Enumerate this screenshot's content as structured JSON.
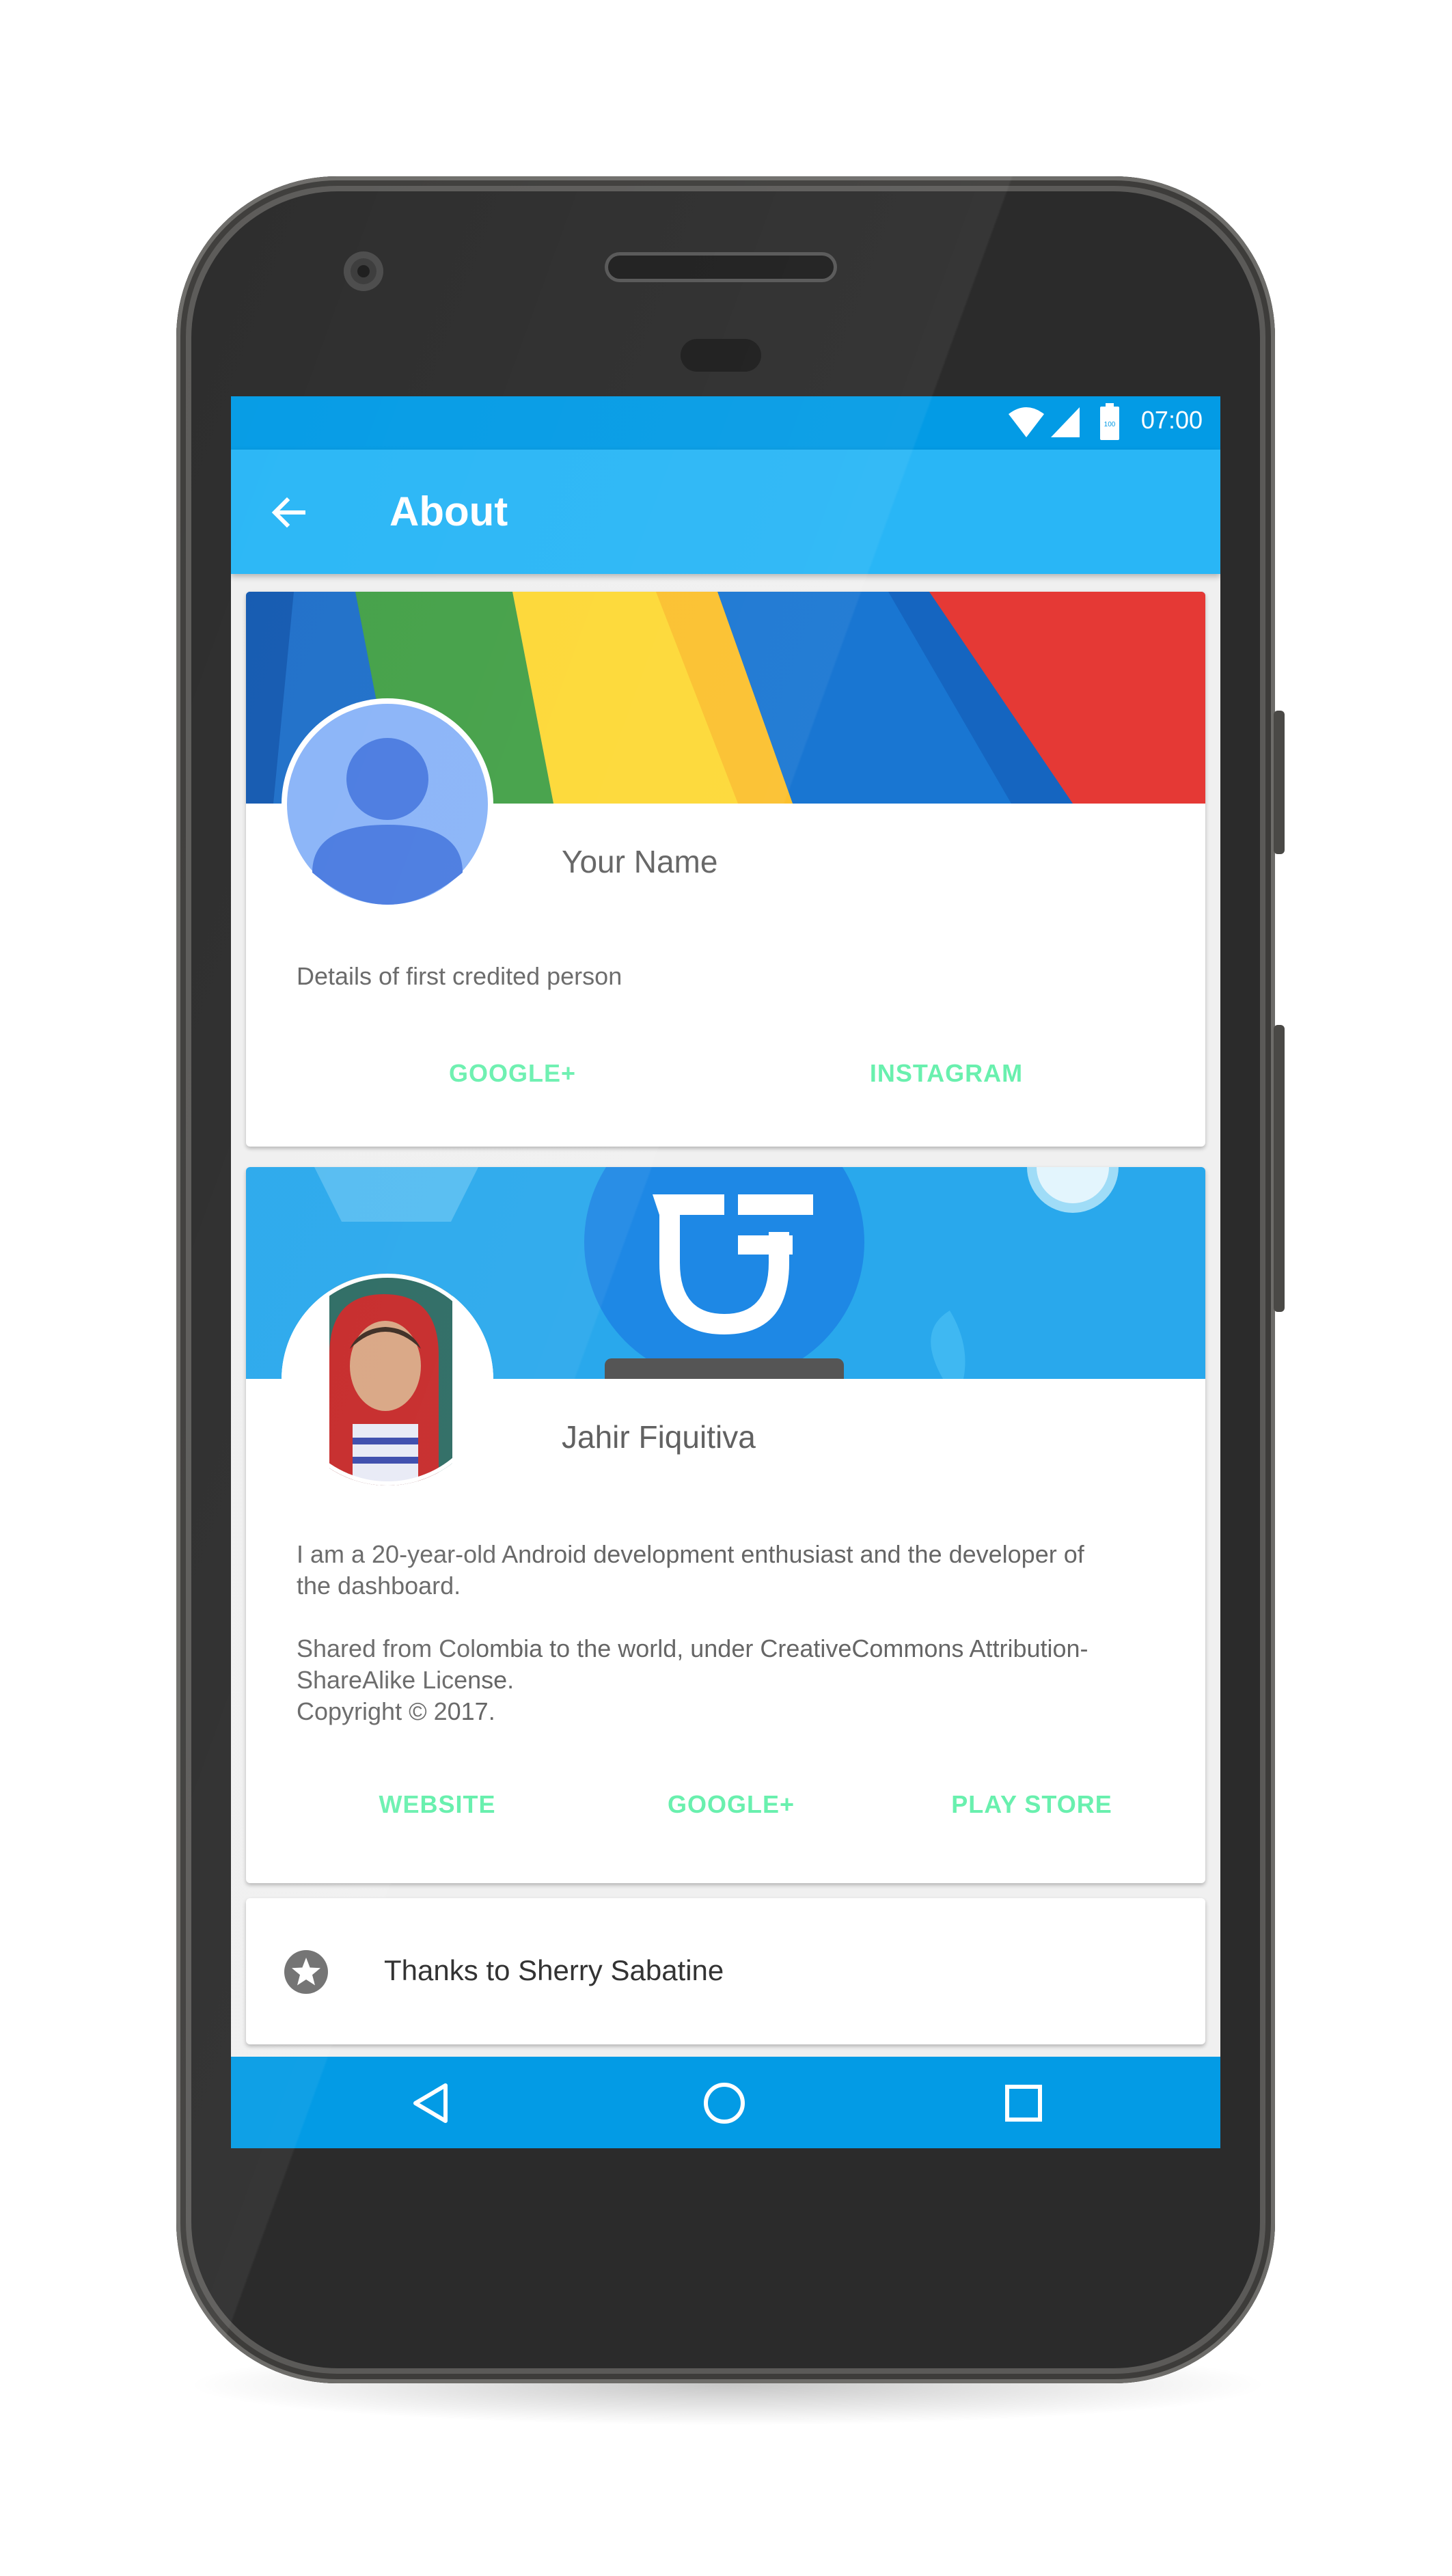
{
  "status_bar": {
    "time": "07:00",
    "battery_level": "100",
    "icons": [
      "wifi-icon",
      "signal-icon",
      "battery-icon"
    ]
  },
  "app_bar": {
    "title": "About",
    "back_icon": "arrow-back-icon"
  },
  "credits": [
    {
      "name": "Your Name",
      "details": "Details of first credited person",
      "buttons": [
        "GOOGLE+",
        "INSTAGRAM"
      ]
    },
    {
      "name": "Jahir Fiquitiva",
      "details_paragraphs": [
        "I am a 20-year-old Android development enthusiast and the developer of",
        "the dashboard.",
        "Shared from Colombia to the world, under CreativeCommons Attribution-",
        "ShareAlike License.",
        "Copyright © 2017."
      ],
      "buttons": [
        "WEBSITE",
        "GOOGLE+",
        "PLAY STORE"
      ]
    }
  ],
  "thanks_item": {
    "icon": "star-circle-icon",
    "label": "Thanks to Sherry Sabatine"
  },
  "nav_bar": {
    "icons": [
      "nav-back-icon",
      "nav-home-icon",
      "nav-recents-icon"
    ]
  },
  "colors": {
    "status_bar": "#039be5",
    "app_bar": "#29b6f6",
    "accent": "#69f0ae",
    "nav_bar": "#039be5"
  }
}
